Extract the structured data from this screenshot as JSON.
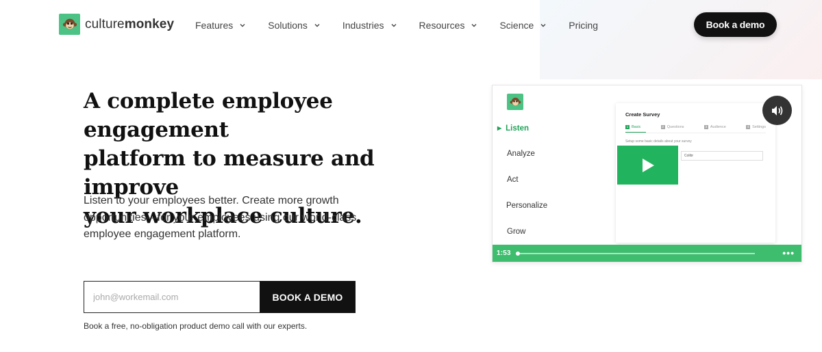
{
  "brand": {
    "name_light": "culture",
    "name_bold": "monkey",
    "logo_icon": "monkey-face-icon",
    "color": "#4cc284"
  },
  "nav": {
    "items": [
      {
        "label": "Features",
        "has_dropdown": true
      },
      {
        "label": "Solutions",
        "has_dropdown": true
      },
      {
        "label": "Industries",
        "has_dropdown": true
      },
      {
        "label": "Resources",
        "has_dropdown": true
      },
      {
        "label": "Science",
        "has_dropdown": true
      },
      {
        "label": "Pricing",
        "has_dropdown": false
      }
    ],
    "cta_label": "Book a demo"
  },
  "hero": {
    "headline_lines": [
      "A complete employee engagement",
      "platform to measure and improve",
      "your workplace culture."
    ],
    "subtext_lines": [
      "Listen to your employees better. Create more growth",
      "opportunities—for your employees using our world-class",
      "employee engagement platform."
    ],
    "email_placeholder": "john@workemail.com",
    "submit_label": "BOOK A DEMO",
    "note": "Book a free, no-obligation product demo call with our experts."
  },
  "video": {
    "sidebar": [
      {
        "label": "Listen",
        "active": true
      },
      {
        "label": "Analyze",
        "active": false
      },
      {
        "label": "Act",
        "active": false
      },
      {
        "label": "Personalize",
        "active": false
      },
      {
        "label": "Grow",
        "active": false
      }
    ],
    "survey": {
      "title": "Create Survey",
      "tabs": [
        {
          "num": "1",
          "label": "Basic"
        },
        {
          "num": "2",
          "label": "Questions"
        },
        {
          "num": "3",
          "label": "Audience"
        },
        {
          "num": "4",
          "label": "Settings"
        }
      ],
      "description": "Setup some basic details about your survey",
      "field_value": "Colibr"
    },
    "time": "1:53",
    "progress_fraction": 0.0,
    "accent": "#3ebd6e",
    "play_icon": "play-icon",
    "sound_icon": "speaker-icon",
    "more_icon": "more-dots-icon"
  }
}
